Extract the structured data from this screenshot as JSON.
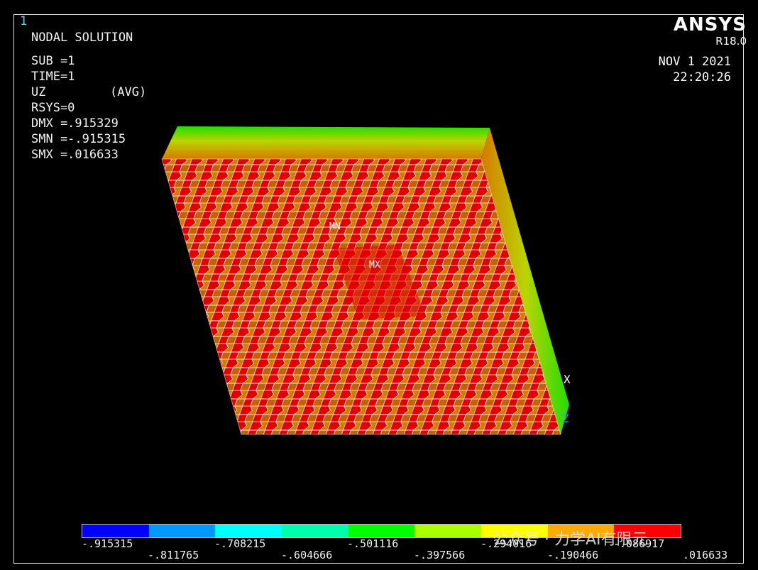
{
  "window": {
    "number": "1"
  },
  "header": {
    "title": "NODAL SOLUTION"
  },
  "info": {
    "sub": "SUB =1",
    "time": "TIME=1",
    "item": "UZ",
    "avg": "(AVG)",
    "rsys": "RSYS=0",
    "dmx": "DMX =.915329",
    "smn": "SMN =-.915315",
    "smx": "SMX =.016633"
  },
  "brand": {
    "name": "ANSYS",
    "version": "R18.0"
  },
  "datetime": {
    "date": "NOV  1 2021",
    "time": "22:20:26"
  },
  "markers": {
    "min": "MN",
    "max": "MX"
  },
  "triad": {
    "x": "X",
    "z": "Z"
  },
  "legend": {
    "colors": [
      "#0000ff",
      "#0099ff",
      "#00ffff",
      "#00ffaa",
      "#00ff00",
      "#aaff00",
      "#ffff00",
      "#ffaa00",
      "#ff0000"
    ],
    "labels_top": [
      "-.915315",
      "-.708215",
      "-.501116",
      "-.294016",
      "-.086917"
    ],
    "labels_bottom": [
      "-.811765",
      "-.604666",
      "-.397566",
      "-.190466",
      ".016633"
    ]
  },
  "watermark": {
    "text": "公众号 · 力学AI有限元"
  },
  "colors": {
    "red": "#e00000",
    "orange": "#d67a00",
    "green": "#22dd00",
    "mesh": "#ffffff"
  }
}
